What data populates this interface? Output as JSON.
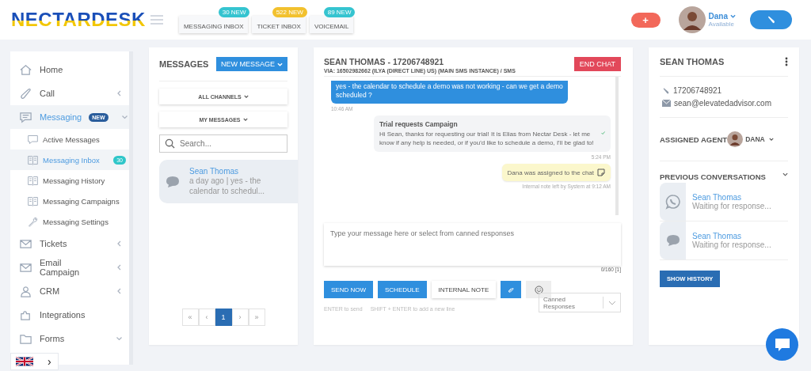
{
  "header": {
    "logo": "NECTARDESK",
    "inboxes": [
      {
        "label": "MESSAGING INBOX",
        "badge": "30 NEW",
        "color": "#35c4d0"
      },
      {
        "label": "TICKET INBOX",
        "badge": "522 NEW",
        "color": "#f2c12e"
      },
      {
        "label": "VOICEMAIL",
        "badge": "89 NEW",
        "color": "#35c4d0"
      }
    ],
    "add_button": "+",
    "user": {
      "name": "Dana",
      "status": "Available"
    }
  },
  "sidebar": {
    "items": [
      {
        "label": "Home",
        "selected": false
      },
      {
        "label": "Call",
        "expanded": false,
        "selected": false
      },
      {
        "label": "Messaging",
        "badge": "NEW",
        "expanded": true,
        "selected": true,
        "children": [
          {
            "label": "Active Messages",
            "selected": false
          },
          {
            "label": "Messaging Inbox",
            "badge": "30",
            "selected": true
          },
          {
            "label": "Messaging History",
            "selected": false
          },
          {
            "label": "Messaging Campaigns",
            "selected": false
          },
          {
            "label": "Messaging Settings",
            "selected": false
          }
        ]
      },
      {
        "label": "Tickets",
        "expanded": false,
        "selected": false
      },
      {
        "label": "Email Campaign",
        "expanded": false,
        "selected": false
      },
      {
        "label": "CRM",
        "expanded": false,
        "selected": false
      },
      {
        "label": "Integrations",
        "selected": false
      },
      {
        "label": "Forms",
        "expanded": true,
        "selected": false
      }
    ],
    "language_chevron": "›"
  },
  "messages": {
    "title": "MESSAGES",
    "new_button": "NEW MESSAGE",
    "filters": [
      "ALL CHANNELS",
      "MY MESSAGES"
    ],
    "search": {
      "placeholder": "Search..."
    },
    "conversations": [
      {
        "name": "Sean Thomas",
        "preview": "a day ago | yes - the calendar to schedul...",
        "selected": true
      }
    ],
    "pages": [
      {
        "label": "«",
        "selected": false
      },
      {
        "label": "‹",
        "selected": false
      },
      {
        "label": "1",
        "selected": true
      },
      {
        "label": "›",
        "selected": false
      },
      {
        "label": "»",
        "selected": false
      }
    ]
  },
  "chat": {
    "title": "SEAN THOMAS - 17206748921",
    "via": "VIA: 16502982662 (ILYA (DIRECT LINE) US) (MAIN SMS INSTANCE) / SMS",
    "end_button": "END CHAT",
    "messages": [
      {
        "kind": "inbound",
        "text": "yes - the calendar to schedule a demo was not working - can we get a demo scheduled ?",
        "meta": "10:46 AM"
      },
      {
        "kind": "outbound",
        "title": "Trial requests Campaign",
        "text": "Hi Sean, thanks for requesting our trial! It is Elias from Nectar Desk - let me know if any help is needed, or if you'd like to schedule a demo, I'll be glad to!",
        "delivered": true,
        "meta": "5:24 PM"
      },
      {
        "kind": "note",
        "text": "Dana was assigned to the chat",
        "meta": "Internal note left by System at 9:12 AM"
      }
    ],
    "composer": {
      "placeholder": "Type your message here or select from canned responses",
      "counter": "0/160 [1]"
    },
    "buttons": [
      {
        "label": "SEND NOW",
        "kind": "primary"
      },
      {
        "label": "SCHEDULE",
        "kind": "primary"
      },
      {
        "label": "INTERNAL NOTE",
        "kind": "plain"
      }
    ],
    "canned": {
      "placeholder": "Canned Responses"
    },
    "hints": [
      "ENTER to send",
      "SHIFT + ENTER to add a new line"
    ]
  },
  "contact": {
    "name": "SEAN THOMAS",
    "phone": "17206748921",
    "email": "sean@elevatedadvisor.com",
    "assigned_label": "ASSIGNED AGENT",
    "agent": "DANA",
    "previous_title": "PREVIOUS CONVERSATIONS",
    "previous": [
      {
        "kind": "whatsapp",
        "name": "Sean Thomas",
        "status": "Waiting for response..."
      },
      {
        "kind": "sms",
        "name": "Sean Thomas",
        "status": "Waiting for response..."
      }
    ],
    "history_button": "SHOW HISTORY"
  }
}
